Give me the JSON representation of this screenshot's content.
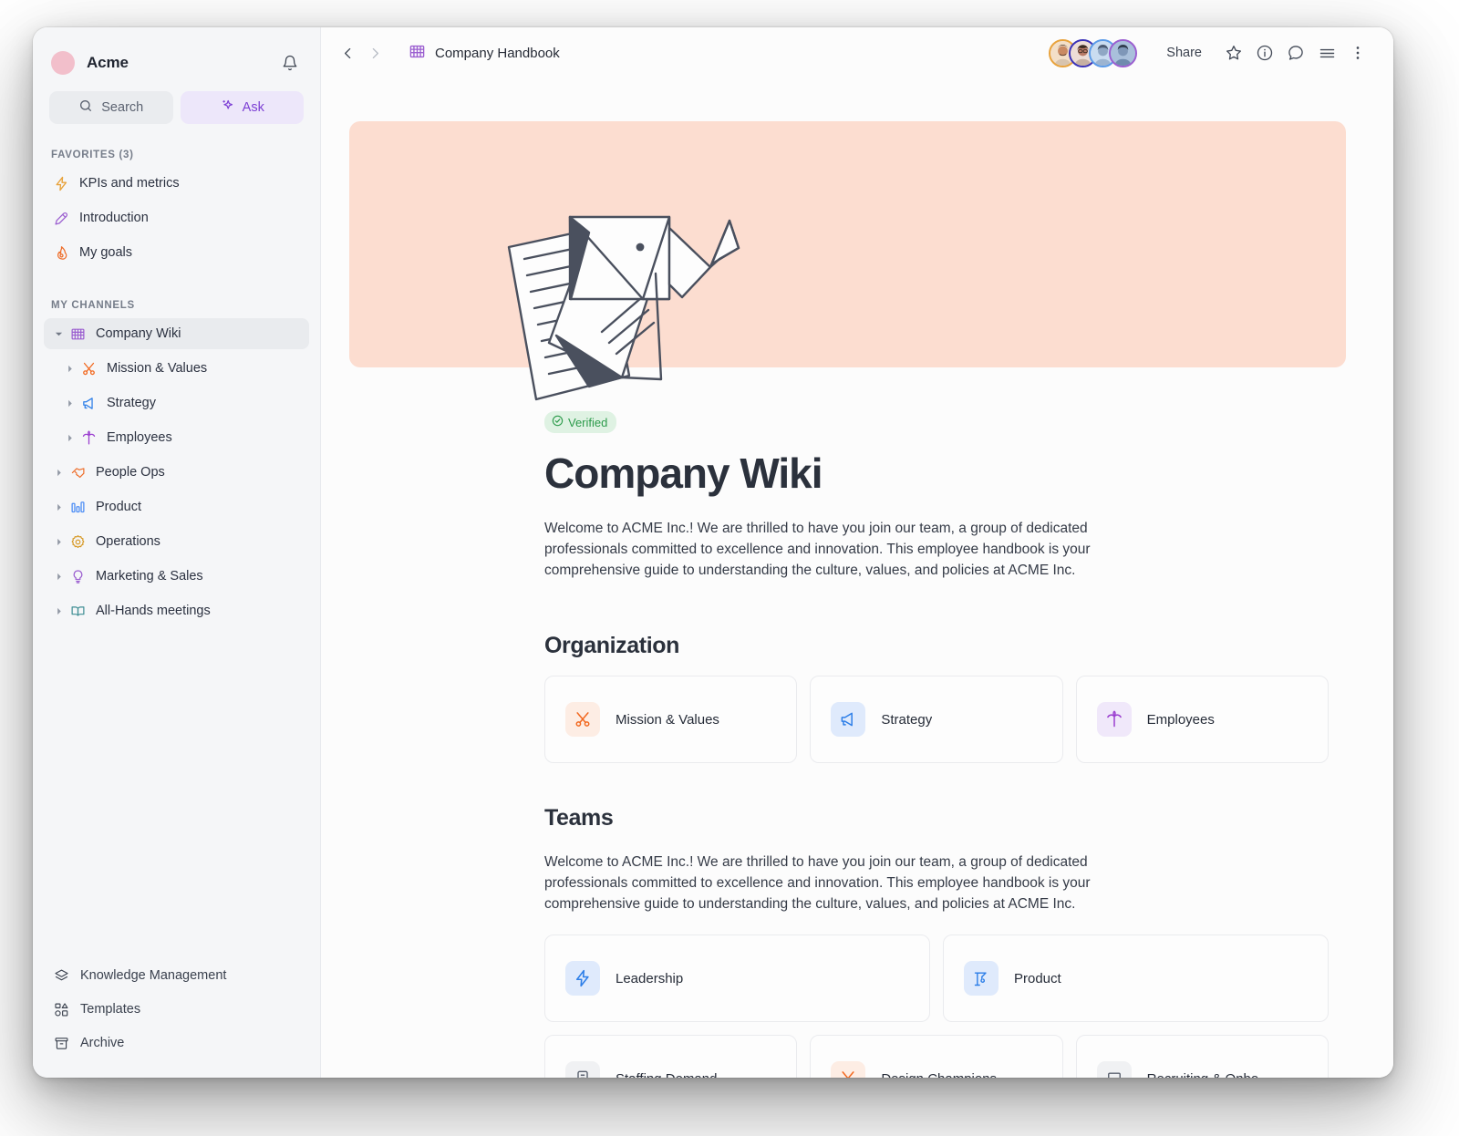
{
  "workspace": {
    "name": "Acme",
    "avatar_color": "#F2BFCB",
    "notifications_icon": "bell-icon"
  },
  "sidebar": {
    "search": {
      "label": "Search",
      "icon": "search-icon"
    },
    "ask": {
      "label": "Ask",
      "icon": "sparkles-icon",
      "color": "#7C3FD4"
    },
    "favorites_header": "FAVORITES (3)",
    "favorites": [
      {
        "label": "KPIs and metrics",
        "icon": "lightning-icon",
        "color": "#E8A33D"
      },
      {
        "label": "Introduction",
        "icon": "microphone-icon",
        "color": "#9B5FD0"
      },
      {
        "label": "My goals",
        "icon": "fire-icon",
        "color": "#EE6E2B"
      }
    ],
    "channels_header": "MY CHANNELS",
    "channels": [
      {
        "label": "Company Wiki",
        "icon": "abacus-icon",
        "color": "#9B5FD0",
        "expanded": true,
        "selected": true,
        "depth": 0
      },
      {
        "label": "Mission & Values",
        "icon": "scissors-icon",
        "color": "#F2681F",
        "expanded": false,
        "selected": false,
        "depth": 1
      },
      {
        "label": "Strategy",
        "icon": "megaphone-icon",
        "color": "#2E7FE8",
        "expanded": false,
        "selected": false,
        "depth": 1
      },
      {
        "label": "Employees",
        "icon": "palm-tree-icon",
        "color": "#9B3FD0",
        "expanded": false,
        "selected": false,
        "depth": 1
      },
      {
        "label": "People Ops",
        "icon": "handshake-icon",
        "color": "#EE6E2B",
        "expanded": false,
        "selected": false,
        "depth": 0
      },
      {
        "label": "Product",
        "icon": "bar-chart-icon",
        "color": "#4D8EF5",
        "expanded": false,
        "selected": false,
        "depth": 0
      },
      {
        "label": "Operations",
        "icon": "gear-icon",
        "color": "#D79A28",
        "expanded": false,
        "selected": false,
        "depth": 0
      },
      {
        "label": "Marketing & Sales",
        "icon": "lightbulb-icon",
        "color": "#9B5FD0",
        "expanded": false,
        "selected": false,
        "depth": 0
      },
      {
        "label": "All-Hands meetings",
        "icon": "open-book-icon",
        "color": "#3E8E94",
        "expanded": false,
        "selected": false,
        "depth": 0
      }
    ],
    "bottom": [
      {
        "label": "Knowledge Management",
        "icon": "layers-icon"
      },
      {
        "label": "Templates",
        "icon": "templates-icon"
      },
      {
        "label": "Archive",
        "icon": "archive-icon"
      }
    ]
  },
  "topbar": {
    "back_icon": "chevron-left-icon",
    "forward_icon": "chevron-right-icon",
    "breadcrumb": {
      "label": "Company Handbook",
      "icon": "abacus-icon"
    },
    "avatars": [
      {
        "ring": "#E8A33D",
        "skin": "#C98A63",
        "hair": "#4A3526",
        "shirt": "#D8C4AE"
      },
      {
        "ring": "#3B33B8",
        "skin": "#B87A66",
        "hair": "#3A2A20",
        "shirt": "#C7B0A2"
      },
      {
        "ring": "#5B9BE8",
        "skin": "#8FA7C4",
        "hair": "#4A5A72",
        "shirt": "#9CB4D1"
      },
      {
        "ring": "#9B5FD0",
        "skin": "#7E97B8",
        "hair": "#2F3B4C",
        "shirt": "#6F8BAE"
      }
    ],
    "share_label": "Share",
    "actions": [
      {
        "icon": "star-icon"
      },
      {
        "icon": "info-icon"
      },
      {
        "icon": "comment-icon"
      },
      {
        "icon": "menu-icon"
      },
      {
        "icon": "more-vertical-icon"
      }
    ]
  },
  "page": {
    "hero_color": "#FCDDD0",
    "hero_illustration": "origami-elephant-with-papers",
    "badge": {
      "label": "Verified",
      "icon": "check-circle-icon",
      "color": "#2C9B4B",
      "bg": "#DFF2E3"
    },
    "title": "Company Wiki",
    "intro": "Welcome to ACME Inc.! We are thrilled to have you join our team, a group of dedicated professionals committed to excellence and innovation. This employee handbook is your comprehensive guide to understanding the culture, values, and policies at ACME Inc.",
    "organization": {
      "heading": "Organization",
      "cards": [
        {
          "label": "Mission & Values",
          "icon": "scissors-icon",
          "color": "#F2681F",
          "bg": "#FDEDE4"
        },
        {
          "label": "Strategy",
          "icon": "megaphone-icon",
          "color": "#2E7FE8",
          "bg": "#DFEAFC"
        },
        {
          "label": "Employees",
          "icon": "palm-tree-icon",
          "color": "#9B3FD0",
          "bg": "#F0E8FA"
        }
      ]
    },
    "teams": {
      "heading": "Teams",
      "intro": "Welcome to ACME Inc.! We are thrilled to have you join our team, a group of dedicated professionals committed to excellence and innovation. This employee handbook is your comprehensive guide to understanding the culture, values, and policies at ACME Inc.",
      "row1": [
        {
          "label": "Leadership",
          "icon": "lightning-icon",
          "color": "#2E7FE8",
          "bg": "#DFEAFC"
        },
        {
          "label": "Product",
          "icon": "crane-icon",
          "color": "#2E7FE8",
          "bg": "#DFEAFC"
        }
      ],
      "row2": [
        {
          "label": "Staffing Demand",
          "icon": "document-icon",
          "color": "#5B6270",
          "bg": "#F0F1F3"
        },
        {
          "label": "Design Champions",
          "icon": "scissors-icon",
          "color": "#F2681F",
          "bg": "#FDEDE4"
        },
        {
          "label": "Recruiting & Onbo…",
          "icon": "laptop-icon",
          "color": "#5B6270",
          "bg": "#F0F1F3"
        }
      ]
    }
  }
}
